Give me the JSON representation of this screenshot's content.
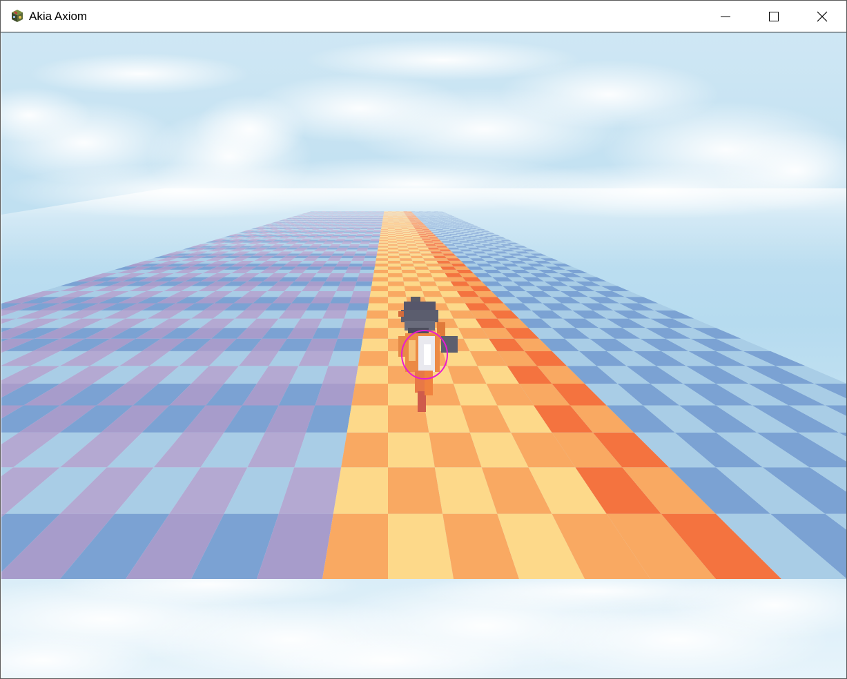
{
  "window": {
    "title": "Akia Axiom",
    "app_icon": "game-cube-icon",
    "controls": {
      "minimize": "minimize-icon",
      "maximize": "maximize-icon",
      "close": "close-icon"
    }
  },
  "scene": {
    "colors": {
      "sky_top": "#cfe5f3",
      "sky_mid": "#a9d3ec",
      "sky_bottom": "#d9eef8",
      "cool_light": "#a9cde6",
      "cool_purple": "#a79ccb",
      "cool_blue": "#7ba2d3",
      "cool_lavender": "#b4a9d2",
      "warm_yellow": "#fdd98a",
      "warm_orange": "#f9a962",
      "hot_orange": "#f4733f",
      "target_ring": "#e91ad2"
    },
    "character": {
      "name": "player-character",
      "facing": "away"
    }
  }
}
